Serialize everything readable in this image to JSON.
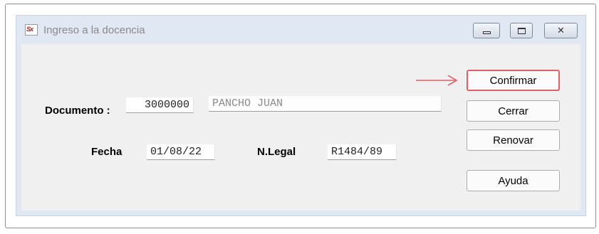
{
  "window": {
    "title": "Ingreso a la docencia"
  },
  "form": {
    "documento_label": "Documento :",
    "documento_value": "3000000",
    "nombre_value": "PANCHO JUAN",
    "fecha_label": "Fecha",
    "fecha_value": "01/08/22",
    "nlegal_label": "N.Legal",
    "nlegal_value": "R1484/89"
  },
  "buttons": {
    "confirmar": "Confirmar",
    "cerrar": "Cerrar",
    "renovar": "Renovar",
    "ayuda": "Ayuda"
  },
  "icons": {
    "app": "sx-app-icon",
    "annotation": "arrow-right-icon"
  },
  "colors": {
    "focus_border": "#e06066",
    "annotation_arrow": "#e06066"
  }
}
